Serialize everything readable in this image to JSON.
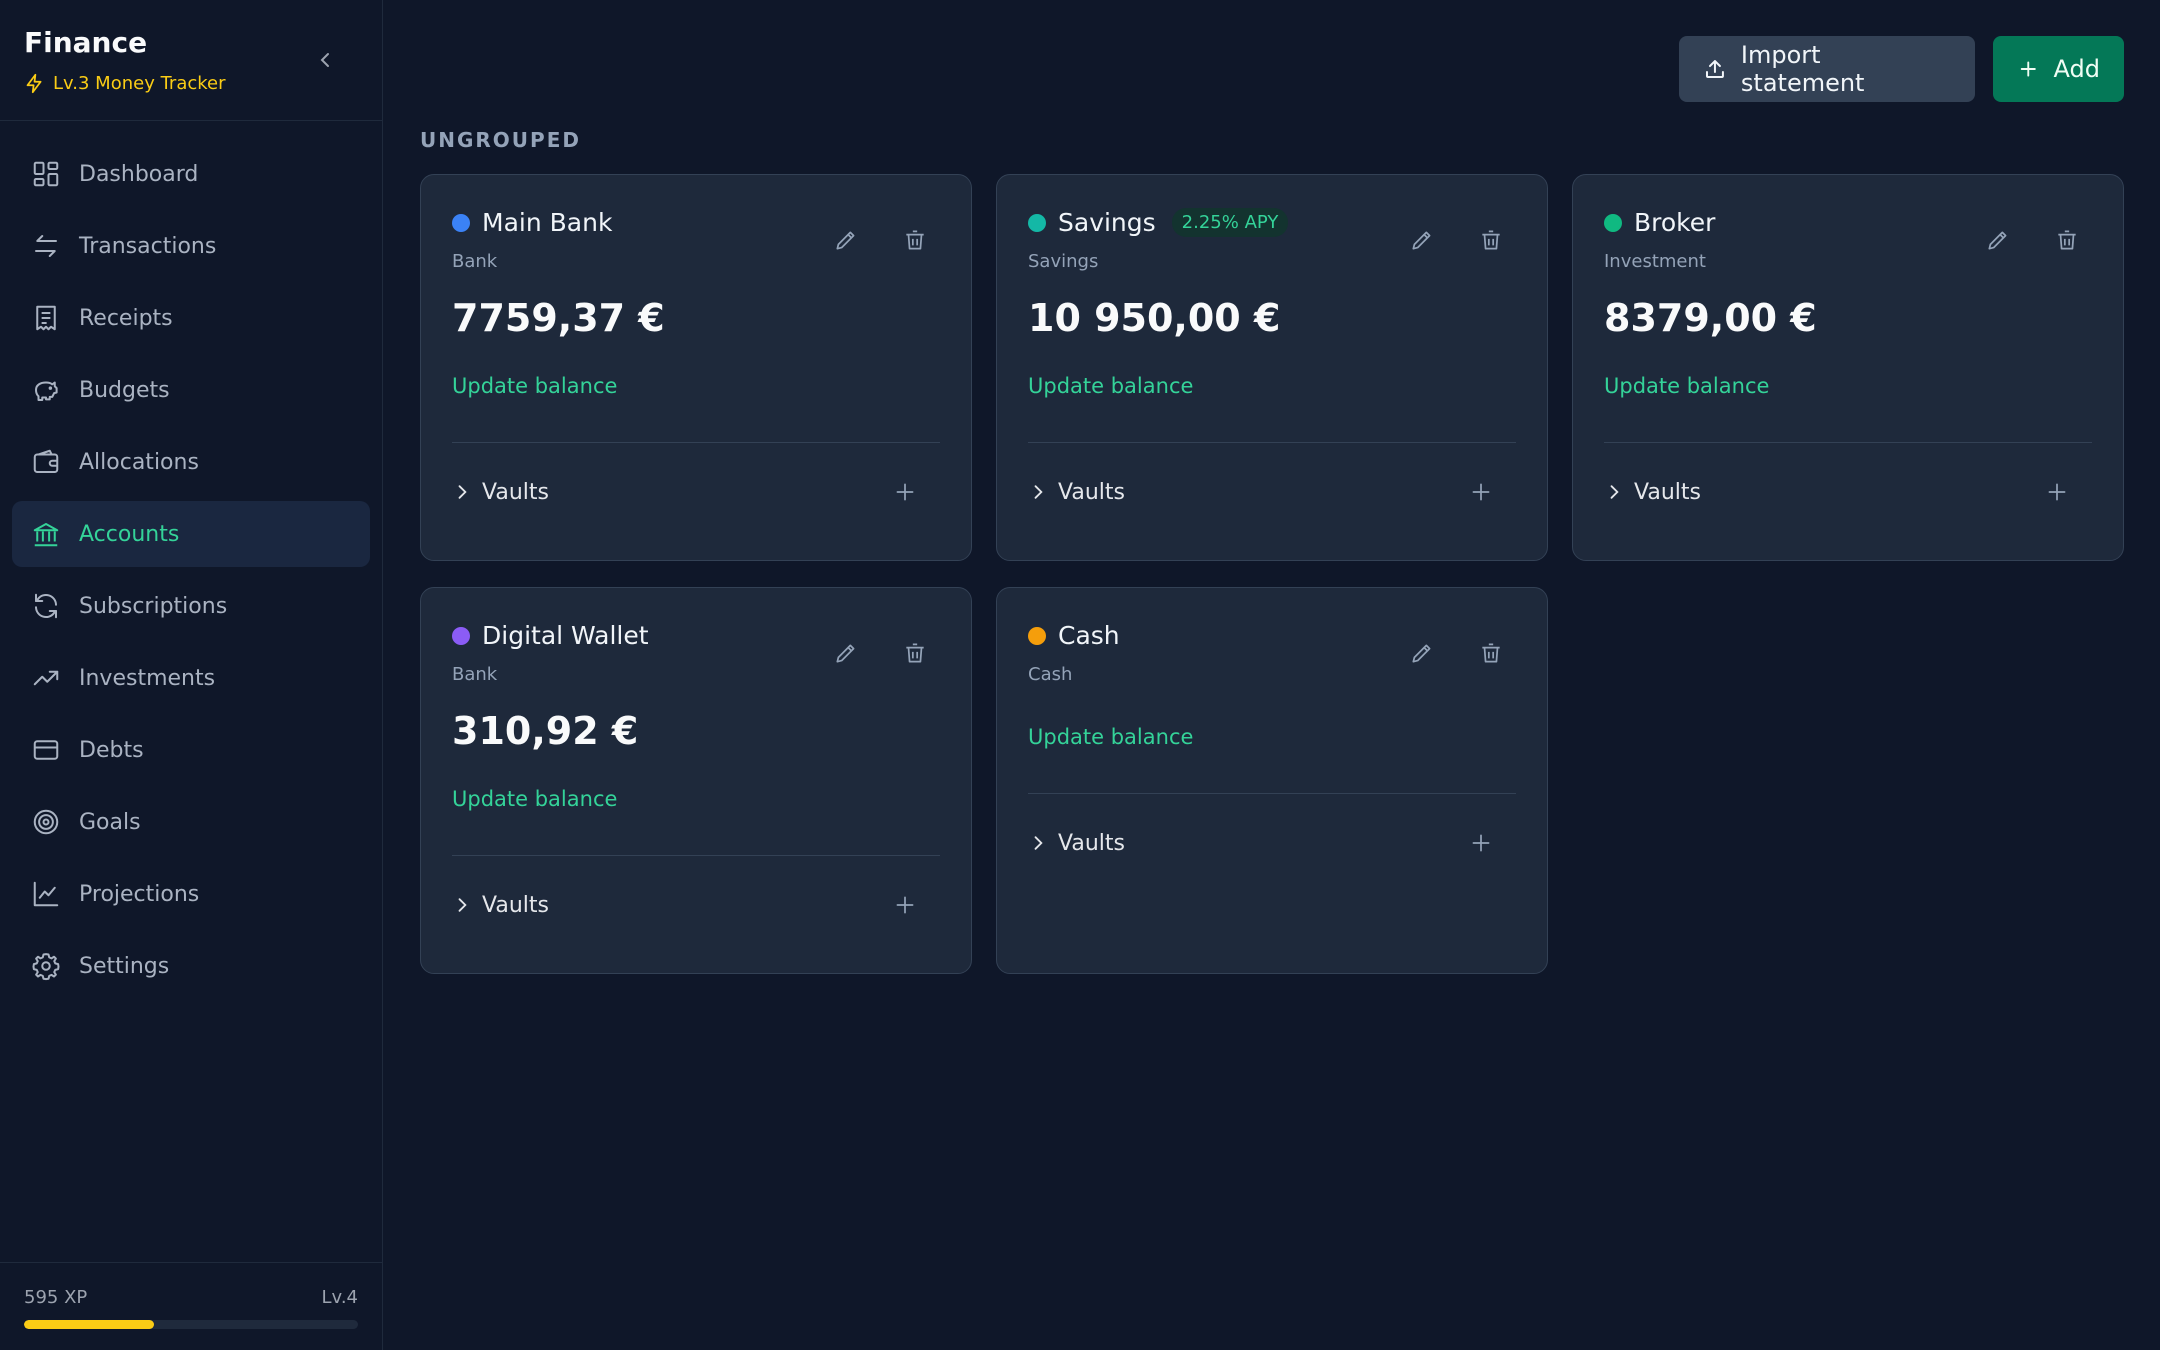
{
  "app": {
    "title": "Finance",
    "level_label": "Lv.3 Money Tracker"
  },
  "nav": {
    "items": [
      {
        "label": "Dashboard",
        "icon": "dashboard-icon"
      },
      {
        "label": "Transactions",
        "icon": "arrows-exchange-icon"
      },
      {
        "label": "Receipts",
        "icon": "receipt-icon"
      },
      {
        "label": "Budgets",
        "icon": "piggy-bank-icon"
      },
      {
        "label": "Allocations",
        "icon": "wallet-icon"
      },
      {
        "label": "Accounts",
        "icon": "bank-icon",
        "active": true
      },
      {
        "label": "Subscriptions",
        "icon": "refresh-icon"
      },
      {
        "label": "Investments",
        "icon": "trending-up-icon"
      },
      {
        "label": "Debts",
        "icon": "credit-card-icon"
      },
      {
        "label": "Goals",
        "icon": "target-icon"
      },
      {
        "label": "Projections",
        "icon": "line-chart-icon"
      },
      {
        "label": "Settings",
        "icon": "gear-icon"
      }
    ]
  },
  "xp": {
    "points": "595 XP",
    "next_level": "Lv.4",
    "progress_percent": 39
  },
  "toolbar": {
    "import_label": "Import statement",
    "add_label": "Add"
  },
  "group": {
    "label": "UNGROUPED"
  },
  "accounts": [
    {
      "name": "Main Bank",
      "type": "Bank",
      "balance": "7759,37 €",
      "dot_color": "#3b82f6",
      "update_label": "Update balance",
      "vaults_label": "Vaults"
    },
    {
      "name": "Savings",
      "type": "Savings",
      "badge": "2.25% APY",
      "balance": "10 950,00 €",
      "dot_color": "#14b8a6",
      "update_label": "Update balance",
      "vaults_label": "Vaults"
    },
    {
      "name": "Broker",
      "type": "Investment",
      "balance": "8379,00 €",
      "dot_color": "#10b981",
      "update_label": "Update balance",
      "vaults_label": "Vaults"
    },
    {
      "name": "Digital Wallet",
      "type": "Bank",
      "balance": "310,92 €",
      "dot_color": "#8b5cf6",
      "update_label": "Update balance",
      "vaults_label": "Vaults"
    },
    {
      "name": "Cash",
      "type": "Cash",
      "balance": "",
      "dot_color": "#f59e0b",
      "update_label": "Update balance",
      "vaults_label": "Vaults"
    }
  ],
  "colors": {
    "accent": "#34d399",
    "background": "#0f1729",
    "card": "#1e293b",
    "xp": "#facc15"
  }
}
